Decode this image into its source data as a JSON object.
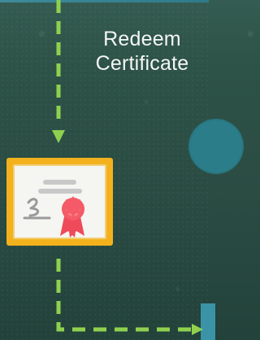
{
  "step": {
    "title_line_1": "Redeem",
    "title_line_2": "Certificate"
  },
  "icons": {
    "certificate": "certificate-icon",
    "arrow": "arrow-icon"
  },
  "colors": {
    "connector": "#8fd14f",
    "circle": "#2b7d8a",
    "block": "#3a93a6",
    "certificate_frame": "#f3b21d",
    "ribbon": "#f45a67"
  }
}
